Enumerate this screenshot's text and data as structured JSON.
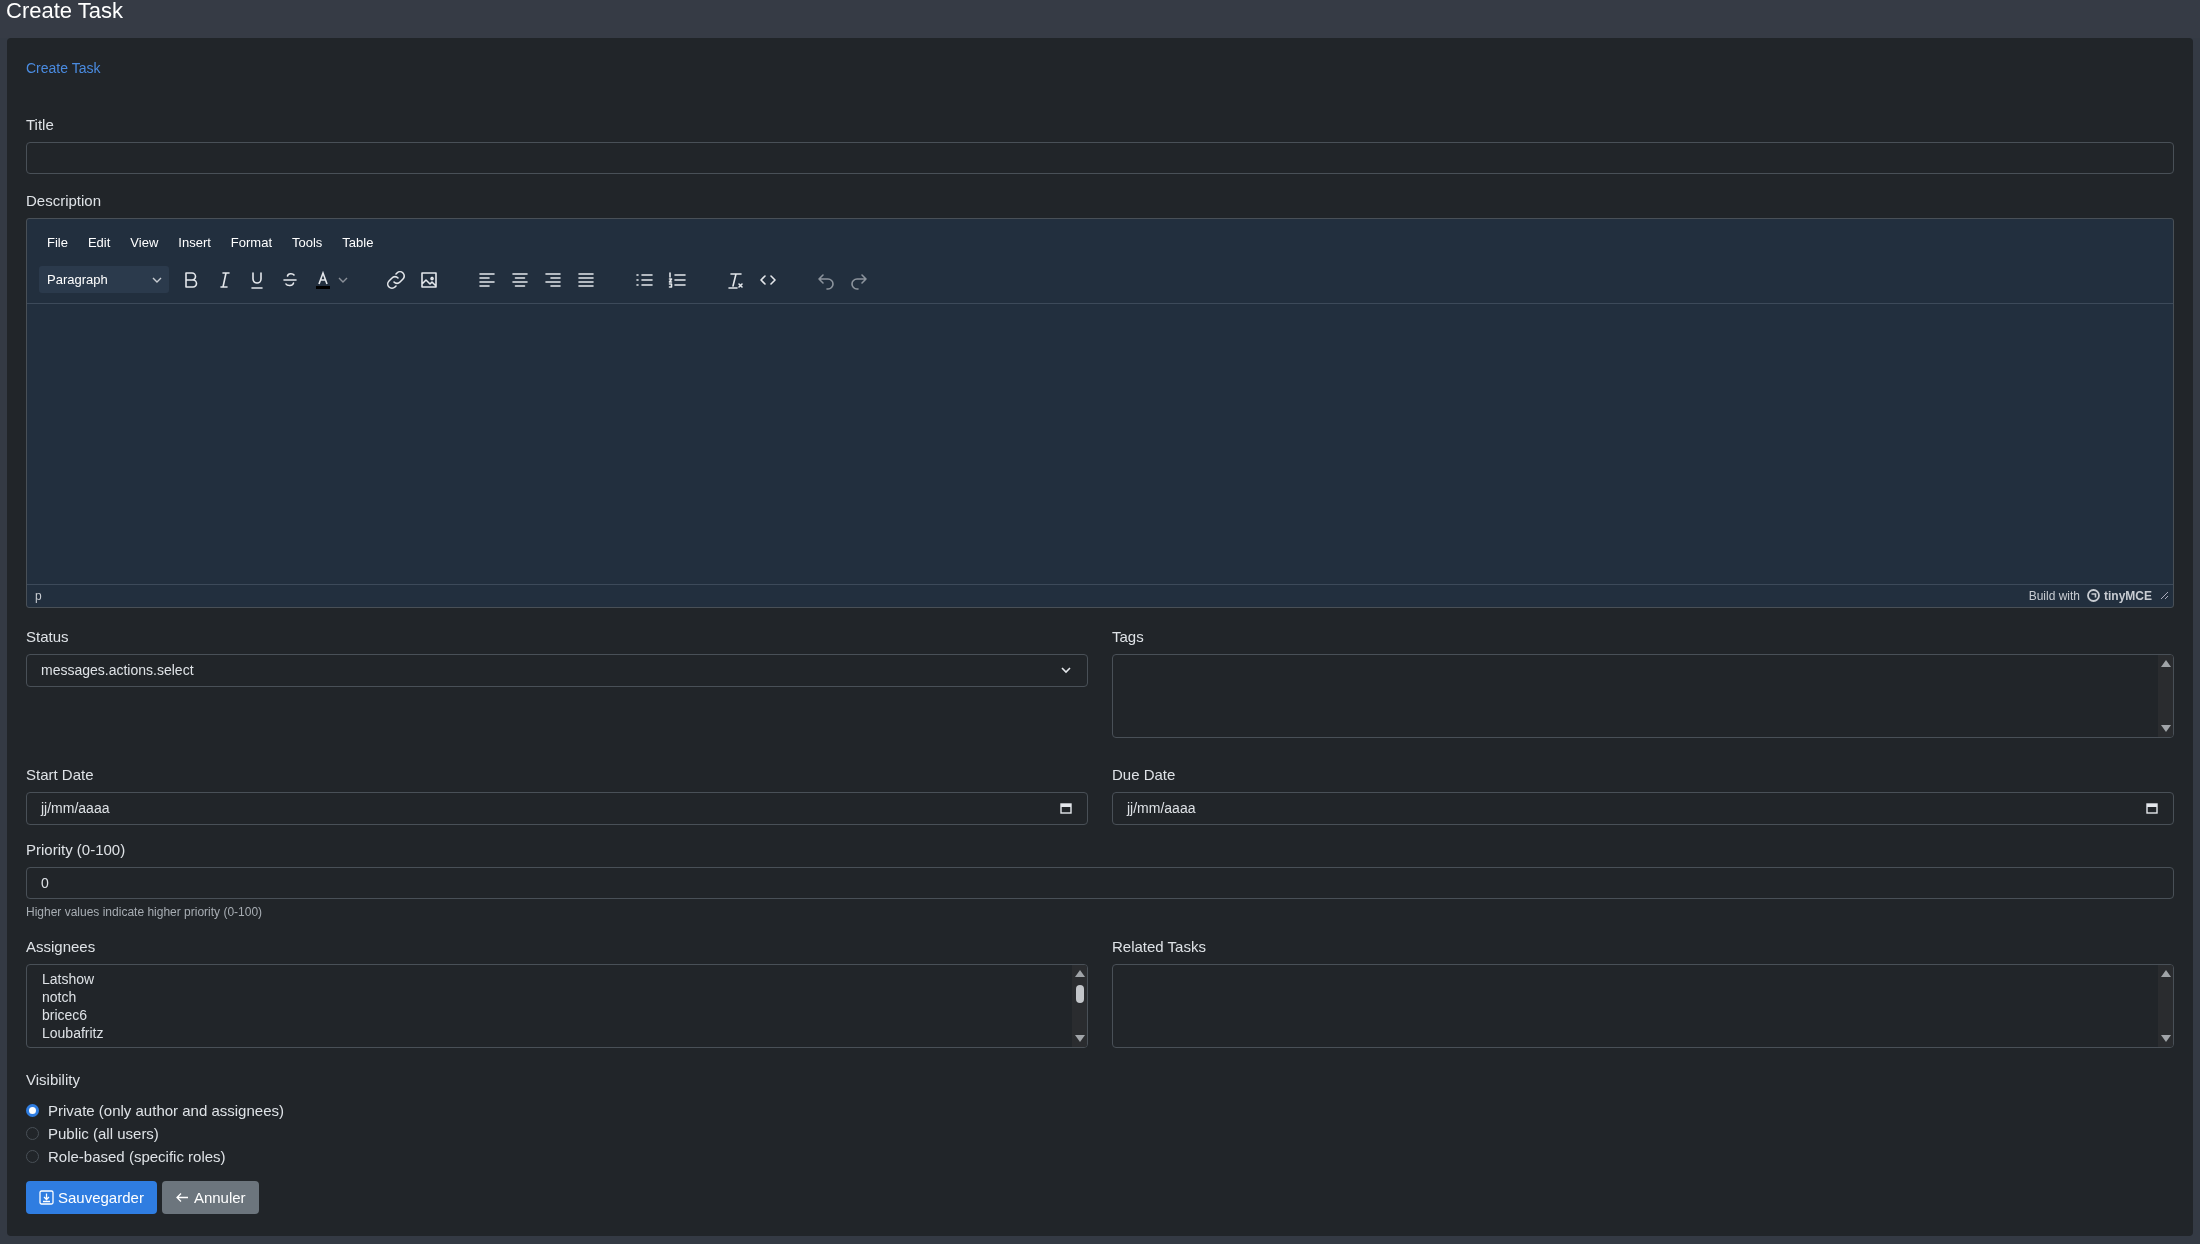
{
  "header": {
    "title": "Create Task"
  },
  "breadcrumb": "Create Task",
  "title_field": {
    "label": "Title"
  },
  "description": {
    "label": "Description",
    "menu": [
      "File",
      "Edit",
      "View",
      "Insert",
      "Format",
      "Tools",
      "Table"
    ],
    "block_format": "Paragraph",
    "path": "p",
    "branding": "Build with",
    "brand": "tinyMCE"
  },
  "status": {
    "label": "Status",
    "value": "messages.actions.select"
  },
  "tags": {
    "label": "Tags"
  },
  "start_date": {
    "label": "Start Date",
    "placeholder": "jj/mm/aaaa"
  },
  "due_date": {
    "label": "Due Date",
    "placeholder": "jj/mm/aaaa"
  },
  "priority": {
    "label": "Priority (0-100)",
    "value": "0",
    "help": "Higher values indicate higher priority (0-100)"
  },
  "assignees": {
    "label": "Assignees",
    "options": [
      "Latshow",
      "notch",
      "bricec6",
      "Loubafritz"
    ]
  },
  "related_tasks": {
    "label": "Related Tasks"
  },
  "visibility": {
    "label": "Visibility",
    "options": [
      {
        "label": "Private (only author and assignees)",
        "selected": true
      },
      {
        "label": "Public (all users)",
        "selected": false
      },
      {
        "label": "Role-based (specific roles)",
        "selected": false
      }
    ]
  },
  "actions": [
    {
      "kind": "primary",
      "label": "Sauvegarder"
    },
    {
      "kind": "secondary",
      "label": "Annuler"
    }
  ]
}
